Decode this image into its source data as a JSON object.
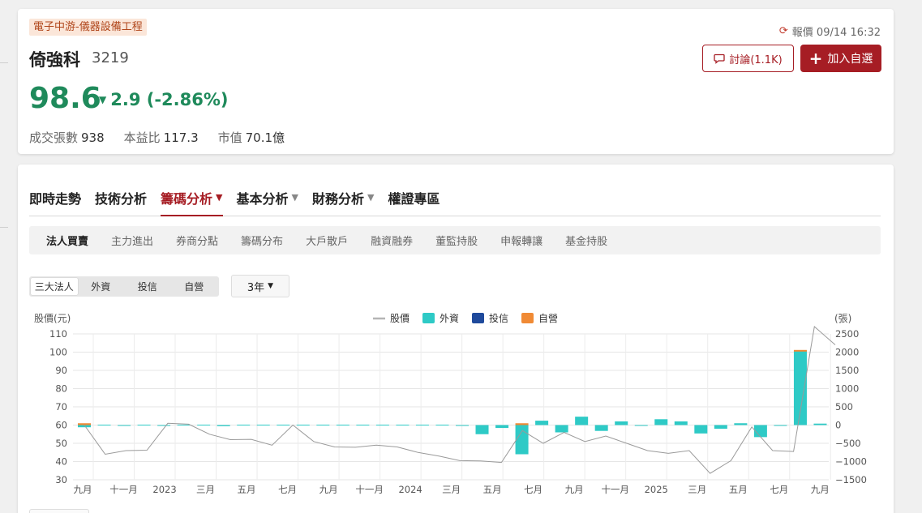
{
  "stock": {
    "industry": "電子中游-儀器設備工程",
    "name": "倚強科",
    "code": "3219",
    "price": "98.6",
    "change_arrow": "▼",
    "change": "2.9 (-2.86%)",
    "quote_time": "報價 09/14 16:32",
    "discuss_label": "討論(1.1K)",
    "watch_label": "加入自選",
    "stats": [
      {
        "label": "成交張數",
        "value": "938"
      },
      {
        "label": "本益比",
        "value": "117.3"
      },
      {
        "label": "市值",
        "value": "70.1億"
      }
    ],
    "colors": {
      "down": "#1f8a5b",
      "brand": "#a61d24",
      "industry_bg": "#fbe6d9"
    }
  },
  "tabs": [
    {
      "label": "即時走勢",
      "has_menu": false
    },
    {
      "label": "技術分析",
      "has_menu": false
    },
    {
      "label": "籌碼分析",
      "has_menu": true,
      "active": true
    },
    {
      "label": "基本分析",
      "has_menu": true
    },
    {
      "label": "財務分析",
      "has_menu": true
    },
    {
      "label": "權證專區",
      "has_menu": false
    }
  ],
  "subtabs": [
    "法人買賣",
    "主力進出",
    "券商分點",
    "籌碼分布",
    "大戶散戶",
    "融資融券",
    "董監持股",
    "申報轉讓",
    "基金持股"
  ],
  "investor_filter": {
    "options": [
      "三大法人",
      "外資",
      "投信",
      "自營"
    ],
    "selected": "三大法人"
  },
  "period": {
    "value": "3年",
    "arrow": "▼"
  },
  "chart_data": {
    "type": "bar+line",
    "left_axis_label": "股價(元)",
    "right_axis_label": "(張)",
    "left_ylim": [
      30,
      110
    ],
    "left_ticks": [
      110,
      100,
      90,
      80,
      70,
      60,
      50,
      40,
      30
    ],
    "right_ylim": [
      -1500,
      2500
    ],
    "right_ticks": [
      "2500",
      "2000",
      "1500",
      "1000",
      "500",
      "0",
      "−500",
      "−1000",
      "−1500"
    ],
    "x_ticks": [
      "九月",
      "十一月",
      "2023",
      "三月",
      "五月",
      "七月",
      "九月",
      "十一月",
      "2024",
      "三月",
      "五月",
      "七月",
      "九月",
      "十一月",
      "2025",
      "三月",
      "五月",
      "七月",
      "九月"
    ],
    "legend": [
      {
        "name": "股價",
        "color": "#b5b5b5",
        "kind": "line"
      },
      {
        "name": "外資",
        "color": "#2ecac6",
        "kind": "box"
      },
      {
        "name": "投信",
        "color": "#1f4a9c",
        "kind": "box"
      },
      {
        "name": "自營",
        "color": "#f08a35",
        "kind": "box"
      }
    ],
    "grid": true,
    "price_line": [
      60,
      44,
      46,
      46.2,
      61,
      60.5,
      55,
      52,
      52.2,
      49,
      60,
      51,
      48,
      47.8,
      49,
      48,
      45,
      43,
      40.5,
      40.3,
      39.5,
      57,
      50,
      56,
      51,
      54,
      50,
      46,
      44.5,
      46,
      33.5,
      40.5,
      59,
      46,
      45.5,
      114,
      104
    ],
    "foreign": [
      -60,
      0,
      -20,
      0,
      -20,
      0,
      0,
      -30,
      0,
      0,
      0,
      0,
      0,
      0,
      0,
      0,
      0,
      0,
      0,
      -20,
      -250,
      -80,
      -800,
      120,
      -200,
      230,
      -160,
      100,
      -20,
      160,
      100,
      -230,
      -100,
      50,
      -330,
      -20,
      2040,
      40
    ],
    "prop": [
      50,
      0,
      0,
      0,
      0,
      0,
      0,
      0,
      0,
      0,
      0,
      0,
      0,
      0,
      0,
      0,
      0,
      0,
      0,
      0,
      0,
      0,
      50,
      0,
      0,
      0,
      0,
      0,
      0,
      0,
      0,
      0,
      0,
      0,
      0,
      0,
      20,
      0
    ]
  }
}
